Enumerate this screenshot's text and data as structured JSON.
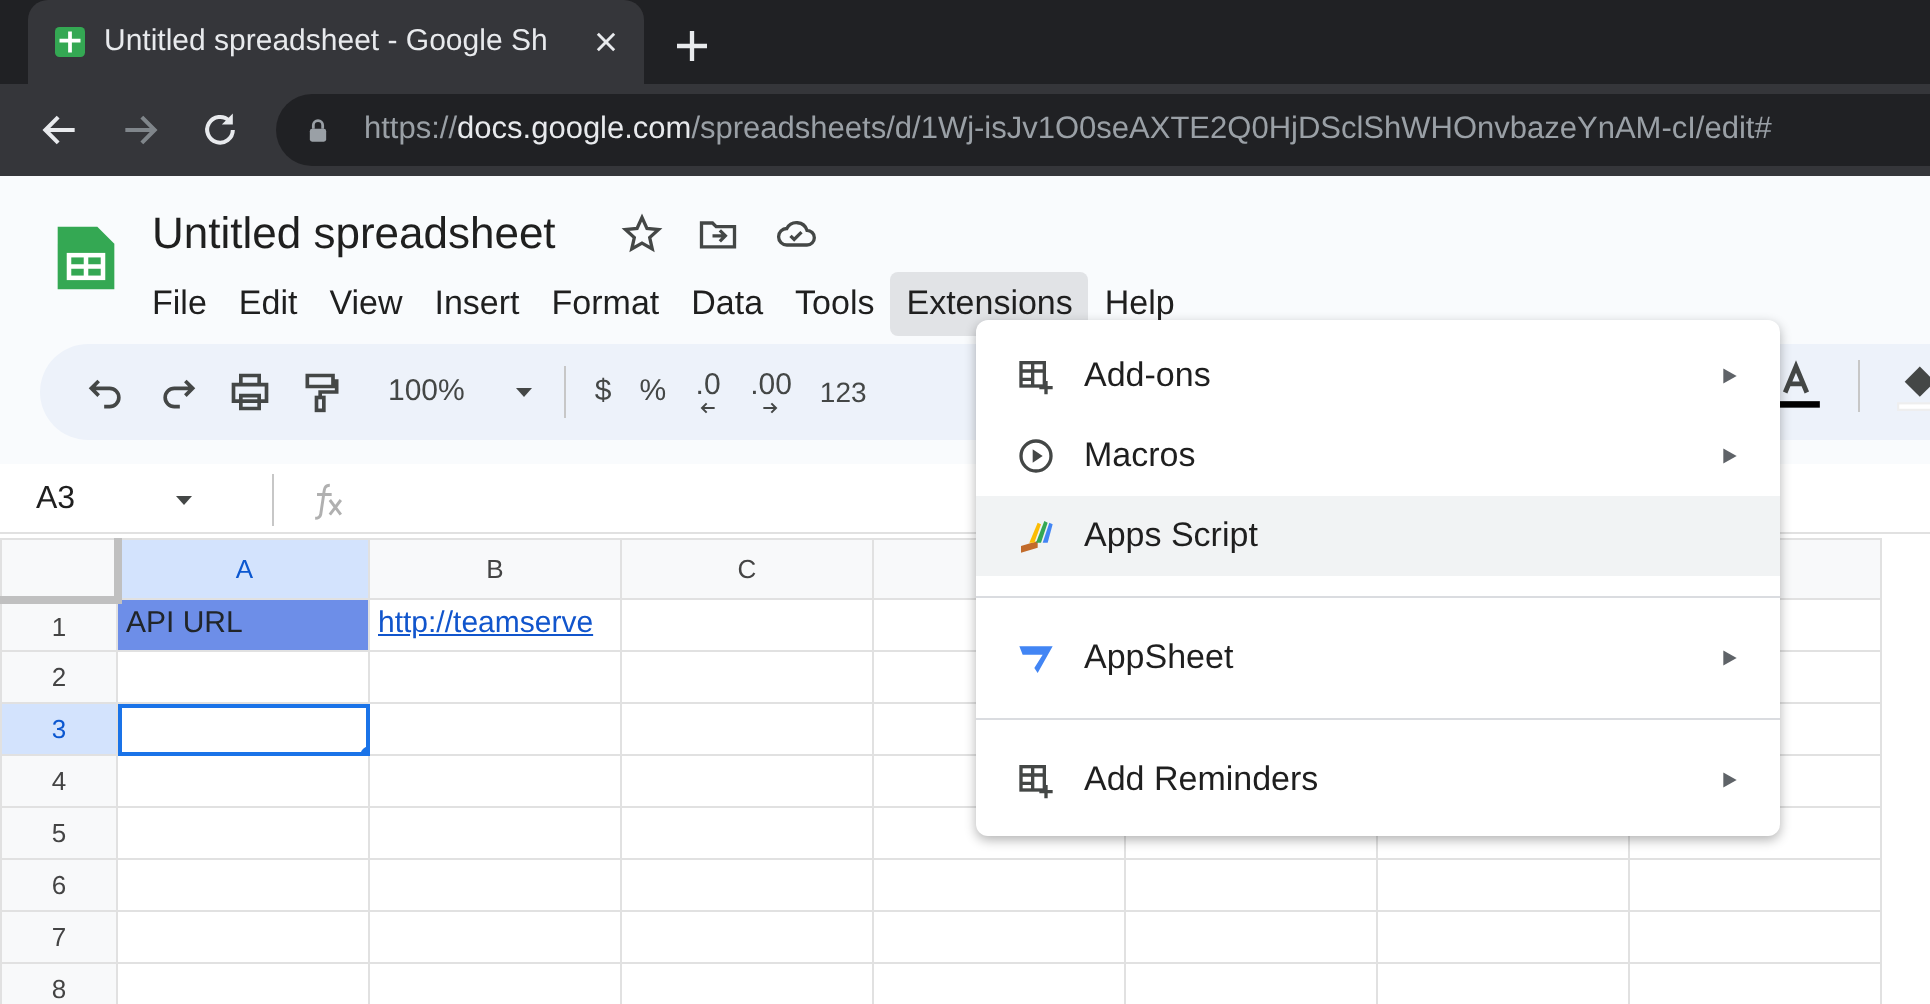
{
  "browser": {
    "tab_title": "Untitled spreadsheet - Google Sh",
    "url": {
      "scheme": "https://",
      "host": "docs.google.com",
      "path": "/spreadsheets/d/1Wj-isJv1O0seAXTE2Q0HjDSclShWHOnvbazeYnAM-cI/edit#"
    }
  },
  "document": {
    "title": "Untitled spreadsheet"
  },
  "menu_bar": [
    {
      "label": "File",
      "selected": false
    },
    {
      "label": "Edit",
      "selected": false
    },
    {
      "label": "View",
      "selected": false
    },
    {
      "label": "Insert",
      "selected": false
    },
    {
      "label": "Format",
      "selected": false
    },
    {
      "label": "Data",
      "selected": false
    },
    {
      "label": "Tools",
      "selected": false
    },
    {
      "label": "Extensions",
      "selected": true
    },
    {
      "label": "Help",
      "selected": false
    }
  ],
  "toolbar": {
    "zoom": "100%",
    "currency": "$",
    "percent": "%",
    "decrease_decimals": ".0",
    "increase_decimals": ".00",
    "number_format": "123"
  },
  "formula_bar": {
    "name_box": "A3"
  },
  "columns": [
    {
      "label": "A",
      "selected": true
    },
    {
      "label": "B",
      "selected": false
    },
    {
      "label": "C",
      "selected": false
    }
  ],
  "rows": [
    {
      "number": "1",
      "selected": false,
      "cells": [
        {
          "text": "API URL",
          "kind": "text",
          "color": "#6d8ee8"
        },
        {
          "text": "http://teamserve",
          "kind": "link"
        }
      ]
    },
    {
      "number": "2",
      "selected": false,
      "cells": []
    },
    {
      "number": "3",
      "selected": true,
      "cells": [
        {
          "kind": "active"
        }
      ]
    },
    {
      "number": "4",
      "selected": false,
      "cells": []
    },
    {
      "number": "5",
      "selected": false,
      "cells": []
    },
    {
      "number": "6",
      "selected": false,
      "cells": []
    },
    {
      "number": "7",
      "selected": false,
      "cells": []
    },
    {
      "number": "8",
      "selected": false,
      "cells": []
    }
  ],
  "extensions_menu": [
    [
      {
        "label": "Add-ons",
        "submenu": true,
        "highlighted": false
      },
      {
        "label": "Macros",
        "submenu": true,
        "highlighted": false
      },
      {
        "label": "Apps Script",
        "submenu": false,
        "highlighted": true
      }
    ],
    [
      {
        "label": "AppSheet",
        "submenu": true,
        "highlighted": false
      }
    ],
    [
      {
        "label": "Add Reminders",
        "submenu": true,
        "highlighted": false
      }
    ]
  ]
}
